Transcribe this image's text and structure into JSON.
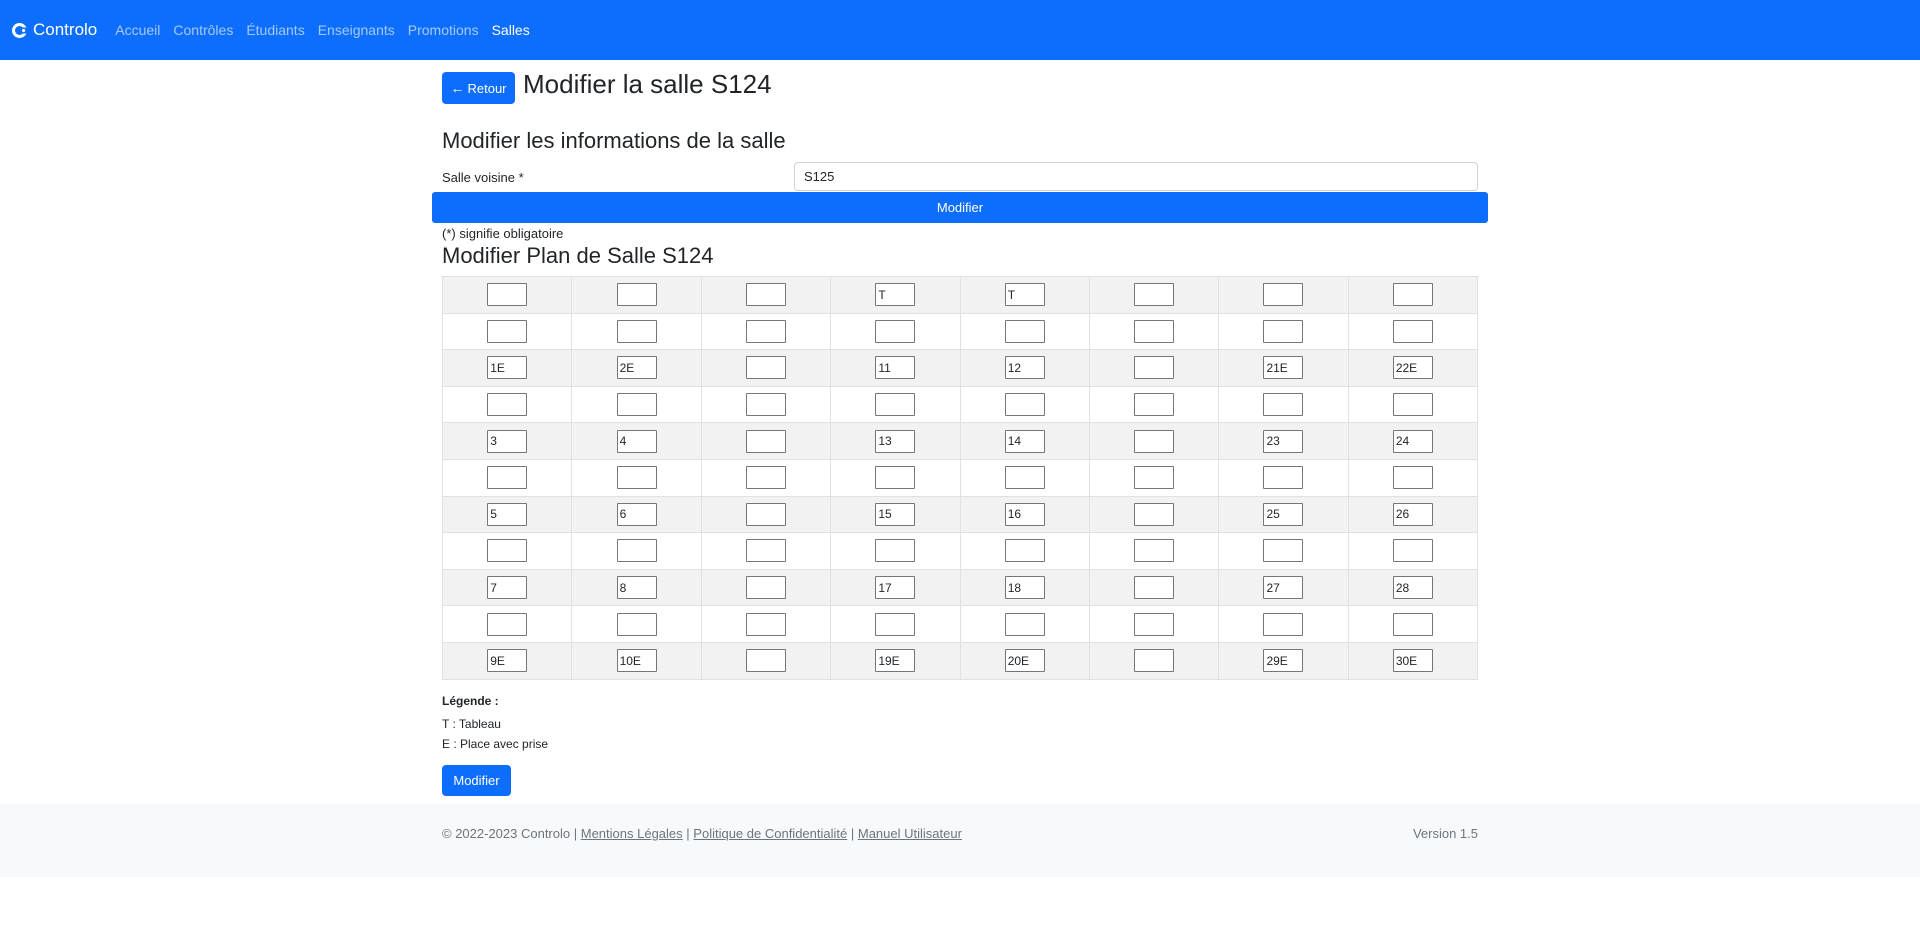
{
  "navbar": {
    "brand": "Controlo",
    "links": [
      "Accueil",
      "Contrôles",
      "Étudiants",
      "Enseignants",
      "Promotions",
      "Salles"
    ],
    "active": "Salles",
    "color": "#0d6efd"
  },
  "header": {
    "back_label": "Retour",
    "title": "Modifier la salle S124"
  },
  "info_form": {
    "title": "Modifier les informations de la salle",
    "neighbor_label": "Salle voisine *",
    "neighbor_value": "S125",
    "submit_label": "Modifier",
    "required_note": "(*) signifie obligatoire"
  },
  "plan": {
    "title": "Modifier Plan de Salle S124",
    "rows": [
      [
        "",
        "",
        "",
        "T",
        "T",
        "",
        "",
        ""
      ],
      [
        "",
        "",
        "",
        "",
        "",
        "",
        "",
        ""
      ],
      [
        "1E",
        "2E",
        "",
        "11",
        "12",
        "",
        "21E",
        "22E"
      ],
      [
        "",
        "",
        "",
        "",
        "",
        "",
        "",
        ""
      ],
      [
        "3",
        "4",
        "",
        "13",
        "14",
        "",
        "23",
        "24"
      ],
      [
        "",
        "",
        "",
        "",
        "",
        "",
        "",
        ""
      ],
      [
        "5",
        "6",
        "",
        "15",
        "16",
        "",
        "25",
        "26"
      ],
      [
        "",
        "",
        "",
        "",
        "",
        "",
        "",
        ""
      ],
      [
        "7",
        "8",
        "",
        "17",
        "18",
        "",
        "27",
        "28"
      ],
      [
        "",
        "",
        "",
        "",
        "",
        "",
        "",
        ""
      ],
      [
        "9E",
        "10E",
        "",
        "19E",
        "20E",
        "",
        "29E",
        "30E"
      ]
    ],
    "legend_title": "Légende :",
    "legend": [
      "T : Tableau",
      "E : Place avec prise"
    ],
    "submit_label": "Modifier"
  },
  "footer": {
    "copyright": "© 2022-2023 Controlo",
    "separator": "|",
    "links": [
      "Mentions Légales",
      "Politique de Confidentialité",
      "Manuel Utilisateur"
    ],
    "version": "Version 1.5"
  }
}
